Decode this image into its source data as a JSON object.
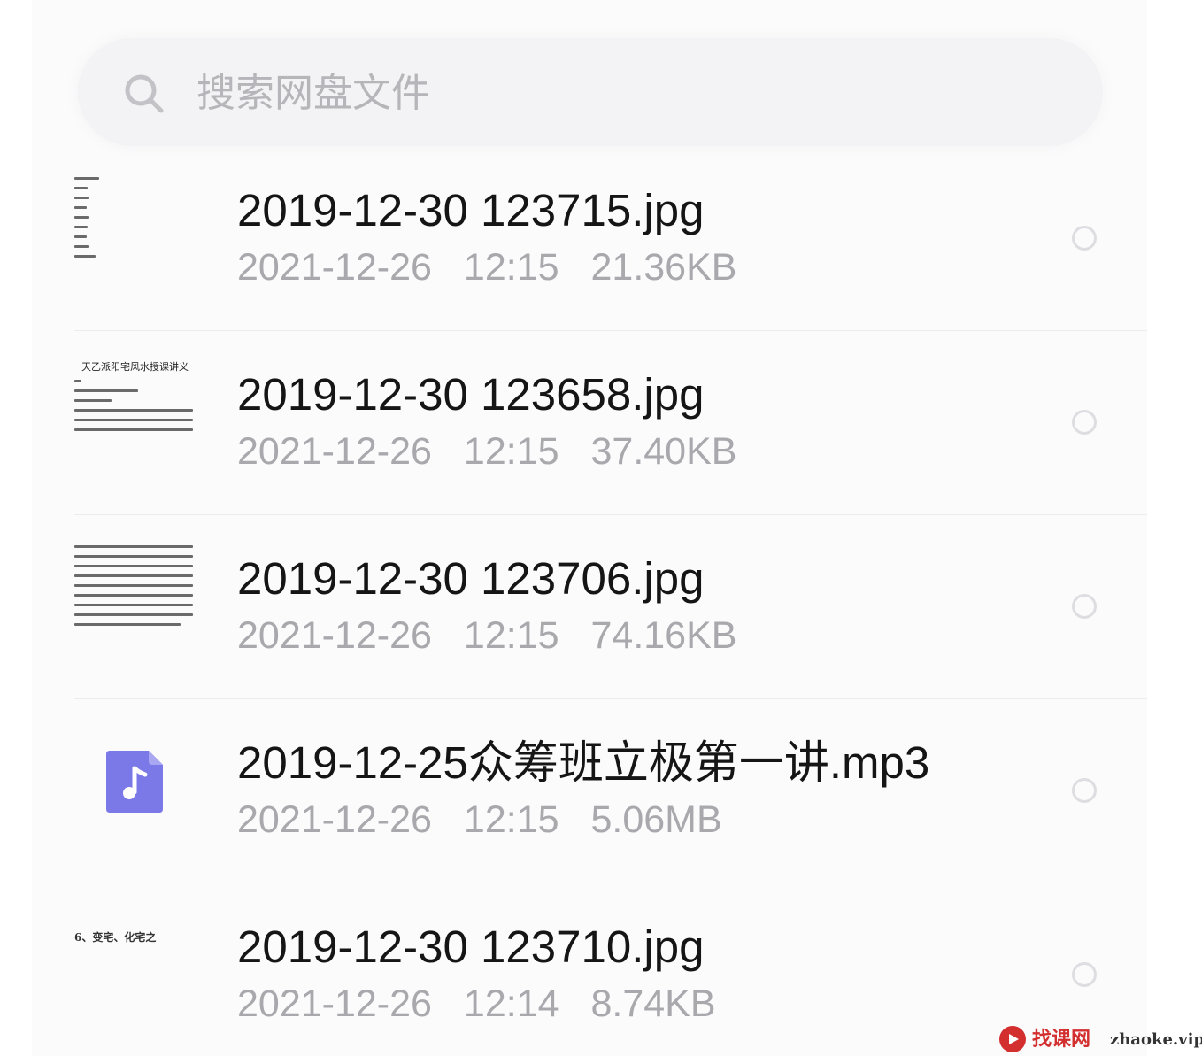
{
  "search": {
    "placeholder": "搜索网盘文件",
    "icon": "search-icon"
  },
  "files": [
    {
      "name": "2019-12-30 123715.jpg",
      "date": "2021-12-26",
      "time": "12:15",
      "size": "21.36KB",
      "thumbnail_type": "image"
    },
    {
      "name": "2019-12-30 123658.jpg",
      "date": "2021-12-26",
      "time": "12:15",
      "size": "37.40KB",
      "thumbnail_type": "image",
      "thumbnail_title": "天乙派阳宅风水授课讲义"
    },
    {
      "name": "2019-12-30 123706.jpg",
      "date": "2021-12-26",
      "time": "12:15",
      "size": "74.16KB",
      "thumbnail_type": "image"
    },
    {
      "name": "2019-12-25众筹班立极第一讲.mp3",
      "date": "2021-12-26",
      "time": "12:15",
      "size": "5.06MB",
      "thumbnail_type": "audio",
      "icon": "music-note-icon",
      "icon_color": "#7b78e8"
    },
    {
      "name": "2019-12-30 123710.jpg",
      "date": "2021-12-26",
      "time": "12:14",
      "size": "8.74KB",
      "thumbnail_type": "image",
      "thumbnail_title": "6、变宅、化宅之"
    }
  ],
  "watermark": {
    "text": "找课网",
    "domain": "zhaoke.vip",
    "accent": "#d32f2f"
  },
  "colors": {
    "text": "#151515",
    "meta": "#a8a8ad",
    "search_bg": "#f3f3f5",
    "divider": "#ececef"
  }
}
